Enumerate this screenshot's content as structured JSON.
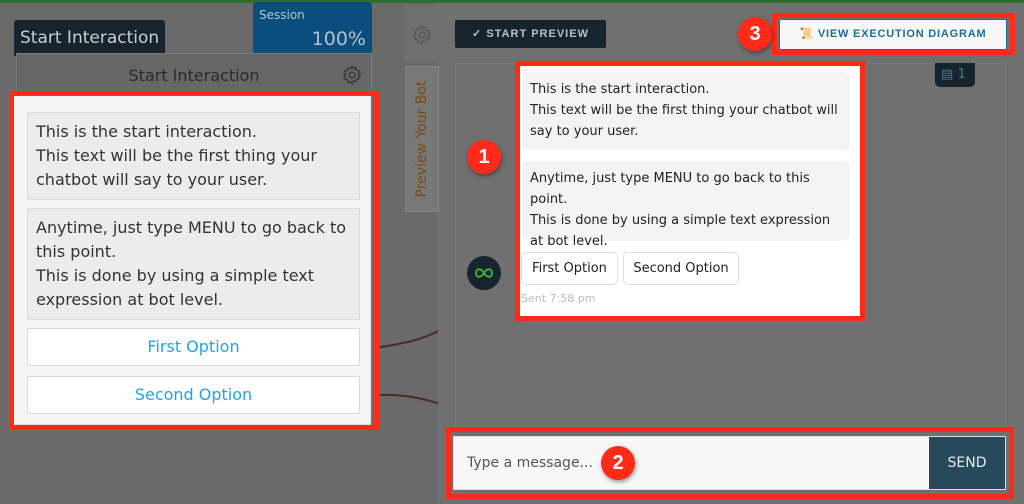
{
  "canvas": {
    "node_tab_label": "Start Interaction",
    "session": {
      "label": "Session",
      "value": "100%"
    },
    "node": {
      "title": "Start Interaction",
      "messages": [
        "This is the start interaction.\nThis text will be the first thing your chatbot will say to your user.",
        "Anytime, just type MENU to go back to this point.\nThis is done by using a simple text expression at bot level."
      ],
      "options": [
        "First Option",
        "Second Option"
      ]
    }
  },
  "side_tabs": {
    "preview_label": "Preview Your Bot"
  },
  "preview": {
    "start_preview_label": "START PREVIEW",
    "view_execution_label": "VIEW EXECUTION DIAGRAM",
    "counter": "1",
    "bubbles": [
      "This is the start interaction.\nThis text will be the first thing your chatbot will say to your user.",
      "Anytime, just type MENU to go back to this point.\nThis is done by using a simple text expression at bot level."
    ],
    "options": [
      "First Option",
      "Second Option"
    ],
    "sent_time": "Sent 7:58 pm",
    "input_placeholder": "Type a message...",
    "send_label": "SEND"
  },
  "annotations": [
    "1",
    "2",
    "3"
  ],
  "colors": {
    "highlight": "#ff2a1a",
    "dark_navy": "#16242d",
    "session_blue": "#0b4d7c",
    "option_link": "#1ea5e6",
    "send_button": "#26495b",
    "preview_tab_text": "#7a4a10"
  }
}
